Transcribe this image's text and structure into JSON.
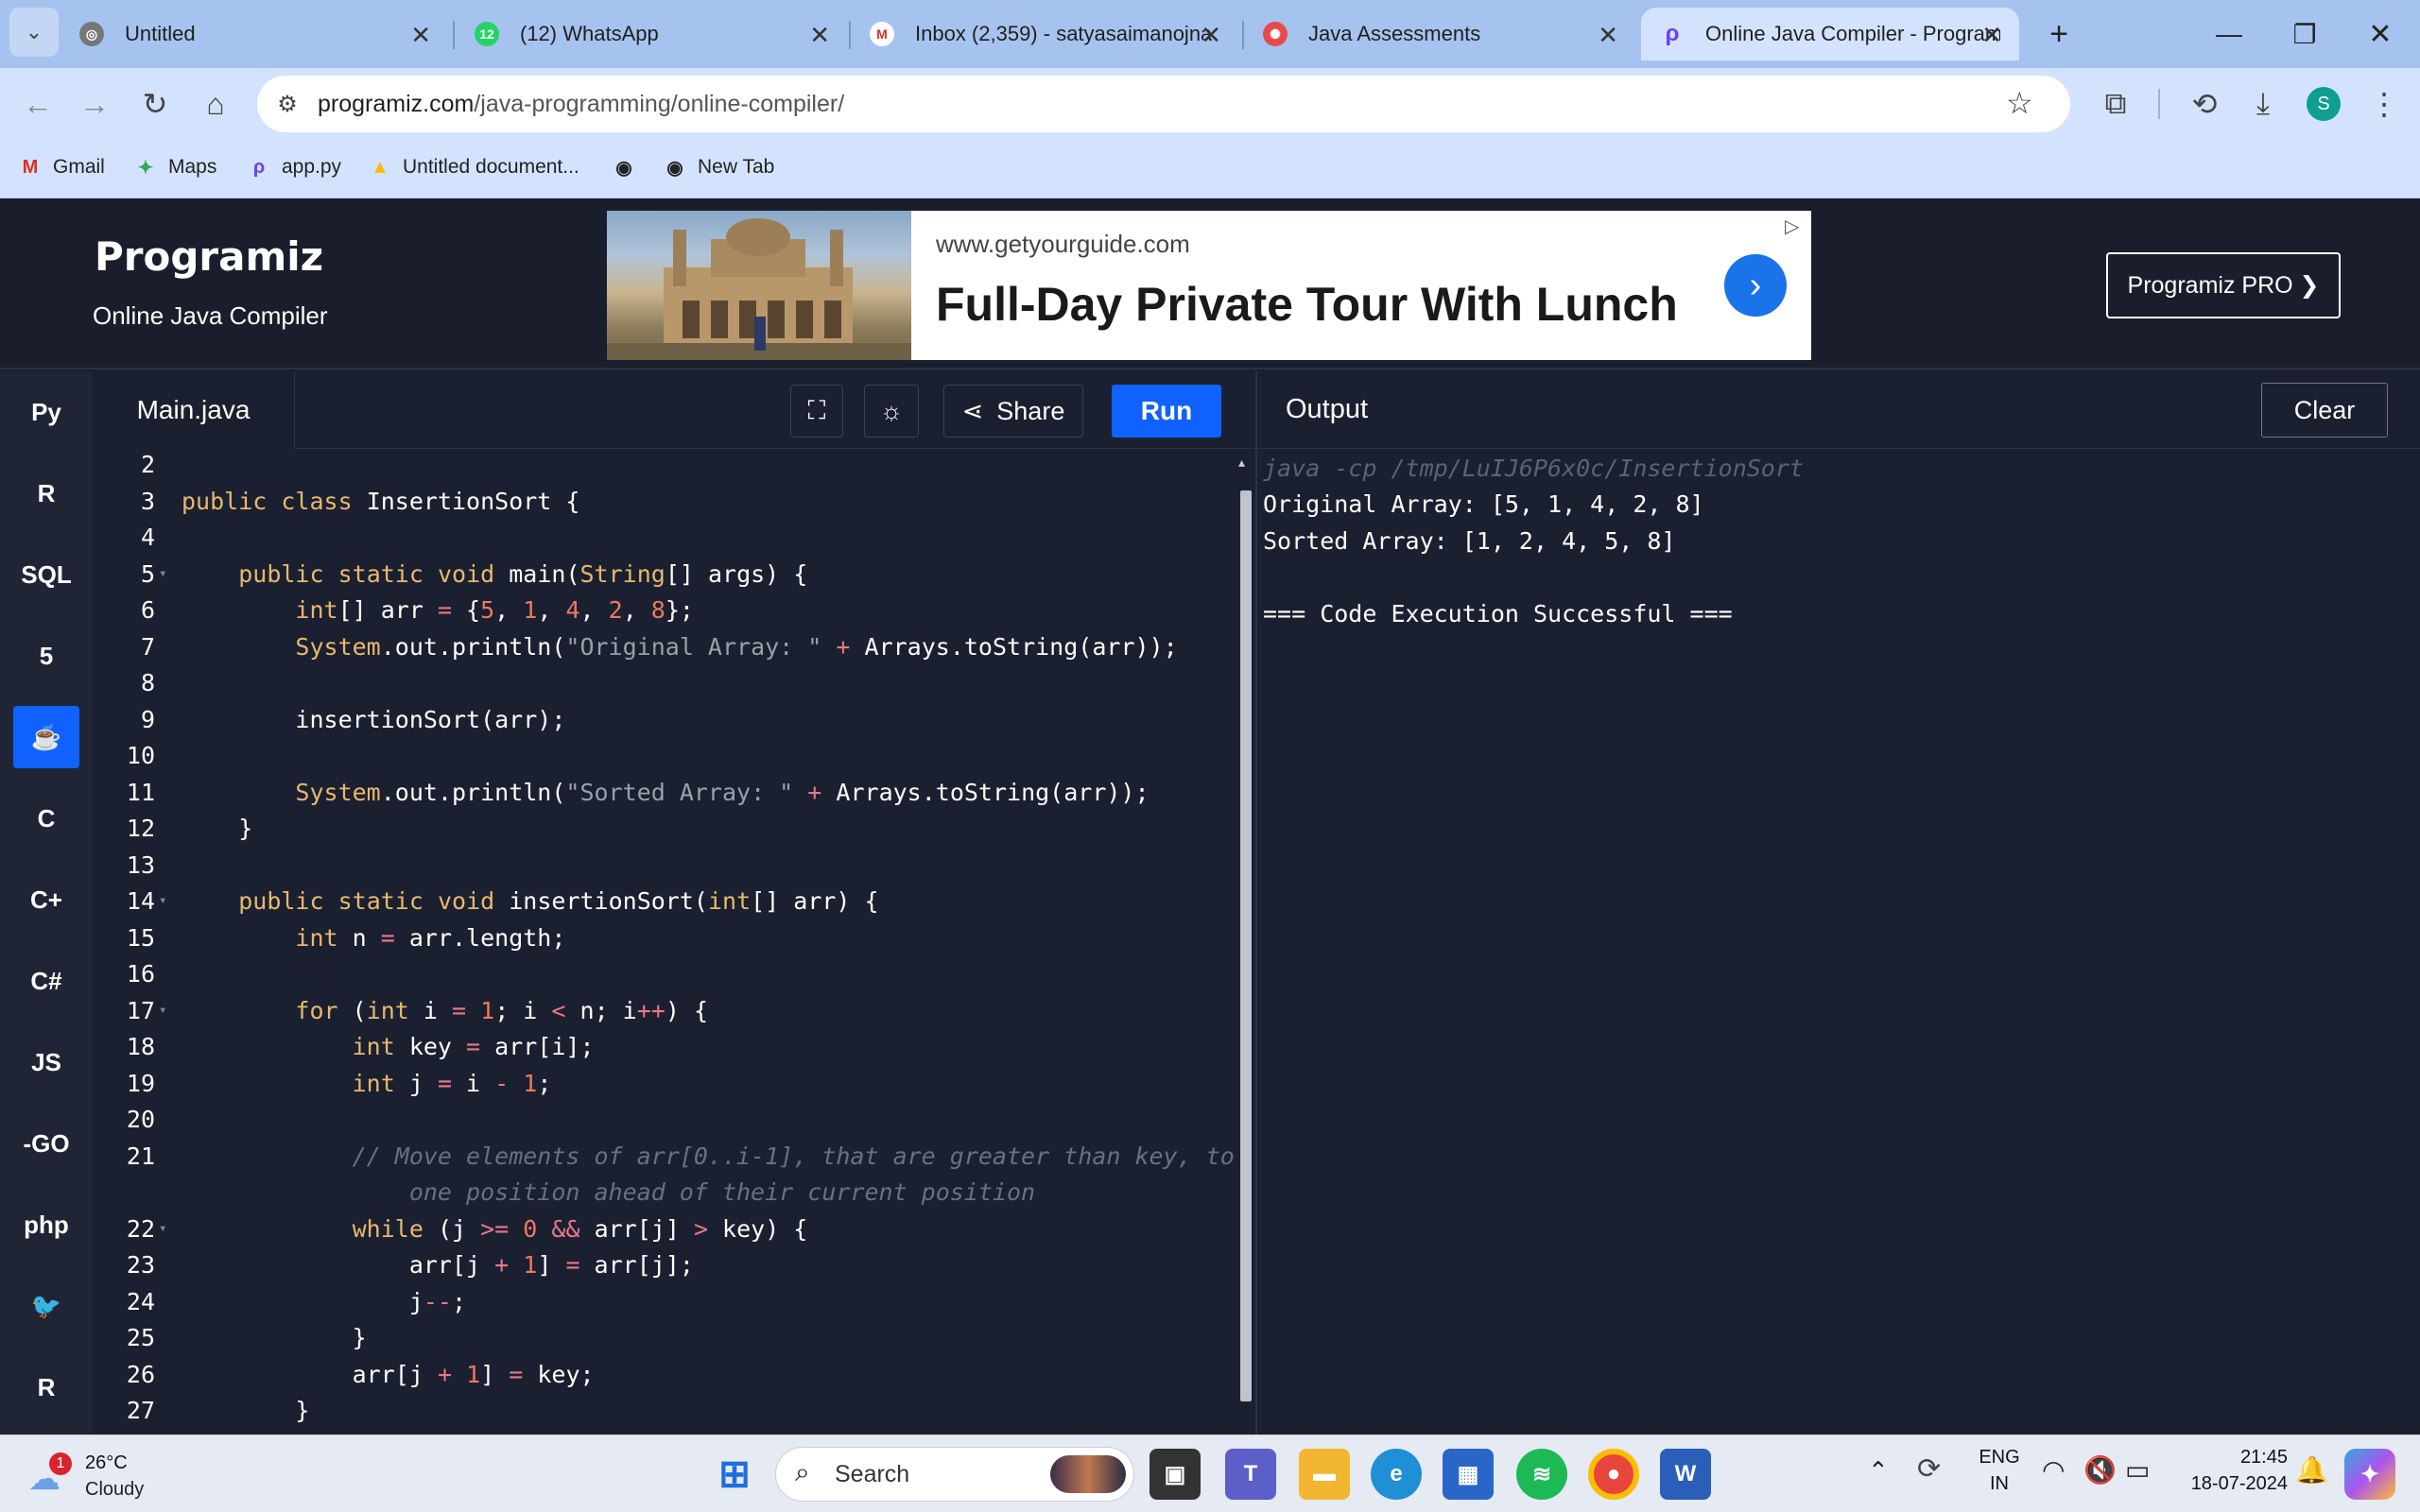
{
  "browser": {
    "tabs": [
      {
        "title": "Untitled",
        "icon": "globe-icon"
      },
      {
        "title": "(12) WhatsApp",
        "icon": "whatsapp-icon",
        "badge": "12"
      },
      {
        "title": "Inbox (2,359) - satyasaimanojna",
        "icon": "gmail-icon"
      },
      {
        "title": "Java Assessments",
        "icon": "assessment-icon"
      },
      {
        "title": "Online Java Compiler - Program",
        "icon": "programiz-icon"
      }
    ],
    "url_host": "programiz.com",
    "url_path": "/java-programming/online-compiler/",
    "bookmarks": [
      {
        "label": "Gmail",
        "icon": "gmail-icon"
      },
      {
        "label": "Maps",
        "icon": "maps-icon"
      },
      {
        "label": "app.py",
        "icon": "programiz-icon"
      },
      {
        "label": "Untitled document...",
        "icon": "drive-icon"
      },
      {
        "label": "",
        "icon": "globe-icon"
      },
      {
        "label": "New Tab",
        "icon": "globe-icon"
      }
    ],
    "profile_letter": "S"
  },
  "site": {
    "logo": "Programiz",
    "subtitle": "Online Java Compiler",
    "pro_button": "Programiz PRO ❯",
    "ad": {
      "domain": "www.getyourguide.com",
      "headline": "Full-Day Private Tour With Lunch"
    }
  },
  "languages": [
    {
      "label": "Py",
      "icon": "python-icon"
    },
    {
      "label": "R",
      "icon": "r-icon"
    },
    {
      "label": "SQL",
      "icon": "database-icon"
    },
    {
      "label": "5",
      "icon": "html5-icon"
    },
    {
      "label": "☕",
      "icon": "java-icon",
      "active": true
    },
    {
      "label": "C",
      "icon": "c-icon"
    },
    {
      "label": "C+",
      "icon": "cpp-icon"
    },
    {
      "label": "C#",
      "icon": "csharp-icon"
    },
    {
      "label": "JS",
      "icon": "javascript-icon"
    },
    {
      "label": "-GO",
      "icon": "go-icon"
    },
    {
      "label": "php",
      "icon": "php-icon"
    },
    {
      "label": "🐦",
      "icon": "swift-icon"
    },
    {
      "label": "R",
      "icon": "rust-icon"
    }
  ],
  "editor": {
    "file_tab": "Main.java",
    "share_label": "Share",
    "run_label": "Run",
    "lines": [
      {
        "n": "2",
        "html": ""
      },
      {
        "n": "3",
        "html": "<span class='kw'>public</span> <span class='kw'>class</span> InsertionSort {"
      },
      {
        "n": "4",
        "html": ""
      },
      {
        "n": "5",
        "fold": true,
        "html": "    <span class='kw'>public</span> <span class='kw'>static</span> <span class='kw'>void</span> main(<span class='kw'>String</span>[] args) {"
      },
      {
        "n": "6",
        "html": "        <span class='kw'>int</span>[] arr <span class='op'>=</span> {<span class='nm'>5</span>, <span class='nm'>1</span>, <span class='nm'>4</span>, <span class='nm'>2</span>, <span class='nm'>8</span>};"
      },
      {
        "n": "7",
        "html": "        <span class='kw'>System</span>.out.println(<span class='st'>\"Original Array: \"</span> <span class='op'>+</span> Arrays.toString(arr));"
      },
      {
        "n": "8",
        "html": ""
      },
      {
        "n": "9",
        "html": "        insertionSort(arr);"
      },
      {
        "n": "10",
        "html": ""
      },
      {
        "n": "11",
        "html": "        <span class='kw'>System</span>.out.println(<span class='st'>\"Sorted Array: \"</span> <span class='op'>+</span> Arrays.toString(arr));"
      },
      {
        "n": "12",
        "html": "    }"
      },
      {
        "n": "13",
        "html": ""
      },
      {
        "n": "14",
        "fold": true,
        "html": "    <span class='kw'>public</span> <span class='kw'>static</span> <span class='kw'>void</span> insertionSort(<span class='kw'>int</span>[] arr) {"
      },
      {
        "n": "15",
        "html": "        <span class='kw'>int</span> n <span class='op'>=</span> arr.length;"
      },
      {
        "n": "16",
        "html": ""
      },
      {
        "n": "17",
        "fold": true,
        "html": "        <span class='kw'>for</span> (<span class='kw'>int</span> i <span class='op'>=</span> <span class='nm'>1</span>; i <span class='op'>&lt;</span> n; i<span class='op'>++</span>) {"
      },
      {
        "n": "18",
        "html": "            <span class='kw'>int</span> key <span class='op'>=</span> arr[i];"
      },
      {
        "n": "19",
        "html": "            <span class='kw'>int</span> j <span class='op'>=</span> i <span class='op'>-</span> <span class='nm'>1</span>;"
      },
      {
        "n": "20",
        "html": ""
      },
      {
        "n": "21",
        "html": "            <span class='cm'>// Move elements of arr[0..i-1], that are greater than key, to</span>"
      },
      {
        "n": "",
        "html": "                <span class='cm'>one position ahead of their current position</span>"
      },
      {
        "n": "22",
        "fold": true,
        "html": "            <span class='kw'>while</span> (j <span class='op'>&gt;=</span> <span class='nm'>0</span> <span class='op'>&amp;&amp;</span> arr[j] <span class='op'>&gt;</span> key) {"
      },
      {
        "n": "23",
        "html": "                arr[j <span class='op'>+</span> <span class='nm'>1</span>] <span class='op'>=</span> arr[j];"
      },
      {
        "n": "24",
        "html": "                j<span class='op'>--</span>;"
      },
      {
        "n": "25",
        "html": "            }"
      },
      {
        "n": "26",
        "html": "            arr[j <span class='op'>+</span> <span class='nm'>1</span>] <span class='op'>=</span> key;"
      },
      {
        "n": "27",
        "html": "        }"
      }
    ]
  },
  "output": {
    "title": "Output",
    "clear_label": "Clear",
    "command": "java -cp /tmp/LuIJ6P6x0c/InsertionSort",
    "lines": [
      "Original Array: [5, 1, 4, 2, 8]",
      "Sorted Array: [1, 2, 4, 5, 8]",
      "",
      "=== Code Execution Successful ==="
    ]
  },
  "taskbar": {
    "weather_temp": "26°C",
    "weather_cond": "Cloudy",
    "weather_badge": "1",
    "search_label": "Search",
    "lang_top": "ENG",
    "lang_bottom": "IN",
    "time": "21:45",
    "date": "18-07-2024"
  }
}
